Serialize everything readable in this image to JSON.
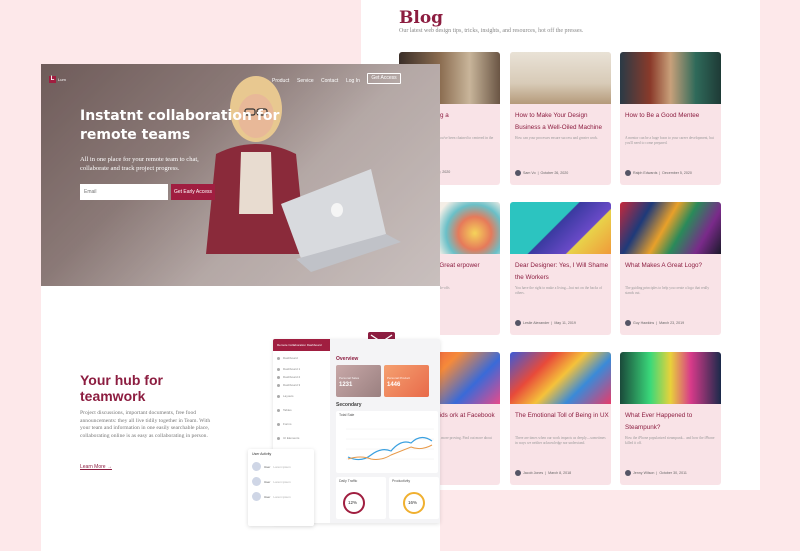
{
  "blog": {
    "title": "Blog",
    "subtitle": "Our latest web design tips, tricks, insights, and resources, hot off the presses.",
    "cards": [
      {
        "title": "s to managing a",
        "excerpt": "longer feature rode from ou've been chained to centered in the ur office. For many",
        "author": "stopher",
        "date": "February 10, 2020"
      },
      {
        "title": "How to Make Your Design Business a Well-Oiled Machine",
        "excerpt": "How can your processes ensure success and greater work.",
        "author": "Sam Vo",
        "date": "October 26, 2020"
      },
      {
        "title": "How to Be a Good Mentee",
        "excerpt": "A mentor can be a huge boon to your career development, but you'll need to come prepared.",
        "author": "Ralph Edwards",
        "date": "December 5, 2020"
      },
      {
        "title": "omise is the Great erpower",
        "excerpt": "your words, the brain trade-offs",
        "author": "",
        "date": "October 16, 2020"
      },
      {
        "title": "Dear Designer: Yes, I Will Shame the Workers",
        "excerpt": "You have the right to make a living—but not on the backs of others.",
        "author": "Leslie Alexander",
        "date": "May 11, 2019"
      },
      {
        "title": "What Makes A Great Logo?",
        "excerpt": "The guiding principles to help you create a logo that really stands out.",
        "author": "Guy Hawkins",
        "date": "March 23, 2019"
      },
      {
        "title": "ain to Your Kids ork at Facebook",
        "excerpt": "ion and our online safety, more proving. Find out more about",
        "author": "",
        "date": "September 9, 2013"
      },
      {
        "title": "The Emotional Toll of Being in UX",
        "excerpt": "There are times when our work impacts us deeply—sometimes in ways we neither acknowledge nor understand.",
        "author": "Jacob Jones",
        "date": "March 8, 2018"
      },
      {
        "title": "What Ever Happened to Steampunk?",
        "excerpt": "How the iPhone popularized steampunk... and how the iPhone killed it off.",
        "author": "Jenny Wilson",
        "date": "October 30, 2011"
      }
    ]
  },
  "hero": {
    "logo_letter": "L",
    "logo_text": "Lum",
    "nav": [
      "Product",
      "Service",
      "Contact",
      "Log In"
    ],
    "nav_button": "Get Access",
    "title": "Instatnt collaboration for remote teams",
    "subtitle": "All in one place for your remote team to chat, collaborate and track project progress.",
    "email_placeholder": "Email",
    "cta": "Get Early Access"
  },
  "hub": {
    "title": "Your hub for teamwork",
    "text": "Project discussions, important documents, free food announcements: they all live tidily together in Team. With your team and information in one easily searchable place, collaborating online is as easy as collaborating in person.",
    "link": "Learn More →"
  },
  "dashboard": {
    "sidebar_header": "Remote Collaboration Dashboard",
    "menu": [
      "Dashboard",
      "Dashboard 1",
      "Dashboard 2",
      "Dashboard 3",
      "Layouts",
      "Tables",
      "Forms",
      "UI Elements"
    ],
    "overview": "Overview",
    "stat1_label": "Personal Sales",
    "stat1_value": "1231",
    "stat2_label": "Personal Product",
    "stat2_value": "1446",
    "secondary": "Secondary",
    "total_sale": "Total Sale",
    "daily_traffic": "Daily Traffic",
    "traffic_value": "12%",
    "productivity": "Productivity",
    "productivity_value": "16%",
    "activity_title": "User Activity",
    "users": [
      {
        "name": "User",
        "desc": "Lorem ipsum"
      },
      {
        "name": "User",
        "desc": "Lorem ipsum"
      },
      {
        "name": "User",
        "desc": "Lorem ipsum"
      }
    ]
  },
  "colors": {
    "brand": "#a01e40",
    "title": "#8c1d40",
    "card_bg": "#f9e3e7",
    "page_bg": "#fde8ea"
  }
}
